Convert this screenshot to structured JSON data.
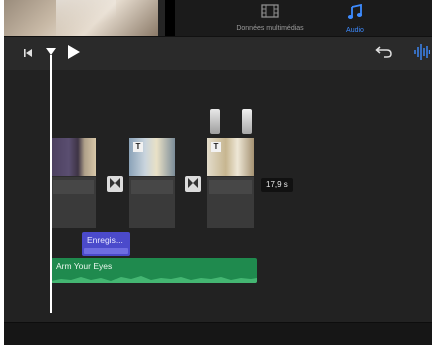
{
  "tabs": {
    "media": {
      "label": "Données multimédias",
      "icon": "film-icon"
    },
    "audio": {
      "label": "Audio",
      "icon": "music-note-icon",
      "active_color": "#3d8bff"
    }
  },
  "toolbar": {
    "skip_start_icon": "skip-to-start-icon",
    "play_icon": "play-icon",
    "undo_icon": "undo-icon",
    "audio_wave_icon": "audio-waveform-icon"
  },
  "timeline": {
    "clip_duration": "17,9 s",
    "voiceover_label": "Enregis...",
    "music_label": "Arm Your Eyes",
    "music_color": "#1f8a4e",
    "voiceover_color": "#4b4acb"
  }
}
